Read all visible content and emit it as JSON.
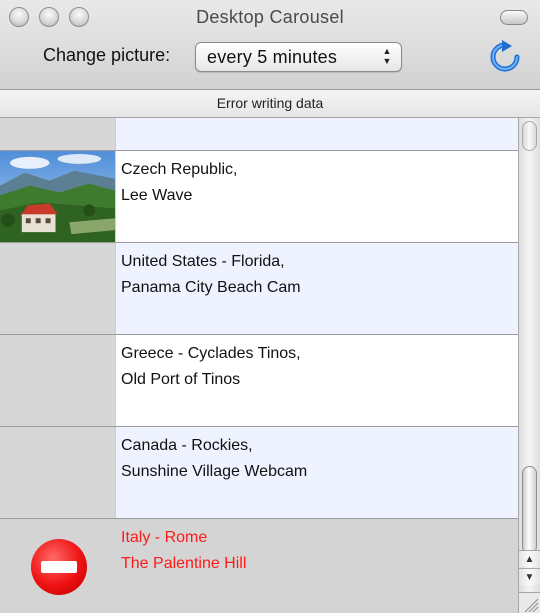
{
  "window": {
    "title": "Desktop Carousel"
  },
  "toolbar": {
    "change_label": "Change picture:",
    "interval_value": "every 5 minutes",
    "refresh_icon": "refresh-icon"
  },
  "status": {
    "text": "Error writing data"
  },
  "list": {
    "items": [
      {
        "line1": "",
        "line2": "",
        "thumbnail": "empty"
      },
      {
        "line1": "Czech Republic,",
        "line2": "Lee Wave",
        "thumbnail": "mountain-landscape"
      },
      {
        "line1": "United States - Florida,",
        "line2": "Panama City Beach Cam",
        "thumbnail": "empty"
      },
      {
        "line1": "Greece - Cyclades Tinos,",
        "line2": "Old Port of Tinos",
        "thumbnail": "empty"
      },
      {
        "line1": "Canada - Rockies,",
        "line2": "Sunshine Village Webcam",
        "thumbnail": "empty"
      },
      {
        "line1": "Italy - Rome",
        "line2": "The Palentine Hill",
        "thumbnail": "error-stop-icon",
        "error": true
      }
    ]
  },
  "colors": {
    "row_alt": "#eef3ff",
    "error_row": "#d4d4d4",
    "error_text": "#ff1a1a",
    "refresh_blue": "#2f7fd6"
  }
}
